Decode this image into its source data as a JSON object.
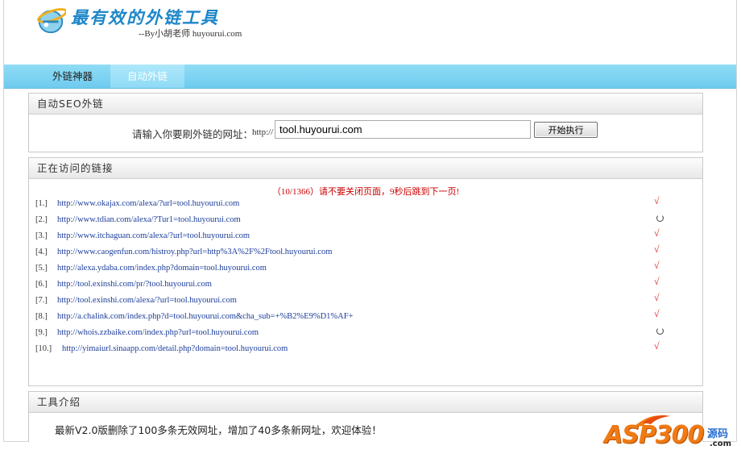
{
  "header": {
    "logo_icon": "ie-globe-icon",
    "title": "最有效的外链工具",
    "subtitle": "--By小胡老师 huyourui.com"
  },
  "nav": {
    "tabs": [
      {
        "label": "外链神器",
        "active": false
      },
      {
        "label": "自动外链",
        "active": true
      }
    ]
  },
  "seo_panel": {
    "title": "自动SEO外链",
    "prompt": "请输入你要刷外链的网址：",
    "prefix": "http://",
    "url_value": "tool.huyourui.com",
    "button_label": "开始执行"
  },
  "links_panel": {
    "title": "正在访问的链接",
    "notice": "（10/1366）请不要关闭页面，9秒后跳到下一页!",
    "links": [
      {
        "num": "[1.]",
        "url": "http://www.okajax.com/alexa/?url=tool.huyourui.com",
        "status": "done"
      },
      {
        "num": "[2.]",
        "url": "http://www.tdian.com/alexa/?Tur1=tool.huyourui.com",
        "status": "loading"
      },
      {
        "num": "[3.]",
        "url": "http://www.itchaguan.com/alexa/?url=tool.huyourui.com",
        "status": "done"
      },
      {
        "num": "[4.]",
        "url": "http://www.caogenfun.com/histroy.php?url=http%3A%2F%2Ftool.huyourui.com",
        "status": "done"
      },
      {
        "num": "[5.]",
        "url": "http://alexa.ydaba.com/index.php?domain=tool.huyourui.com",
        "status": "done"
      },
      {
        "num": "[6.]",
        "url": "http://tool.exinshi.com/pr/?tool.huyourui.com",
        "status": "done"
      },
      {
        "num": "[7.]",
        "url": "http://tool.exinshi.com/alexa/?url=tool.huyourui.com",
        "status": "done"
      },
      {
        "num": "[8.]",
        "url": "http://a.chalink.com/index.php?d=tool.huyourui.com&cha_sub=+%B2%E9%D1%AF+",
        "status": "done"
      },
      {
        "num": "[9.]",
        "url": "http://whois.zzbaike.com/index.php?url=tool.huyourui.com",
        "status": "loading"
      },
      {
        "num": "[10.]",
        "url": "http://yimaiurl.sinaapp.com/detail.php?domain=tool.huyourui.com",
        "status": "done"
      }
    ],
    "check_mark": "√",
    "colors": {
      "check": "#e02020",
      "link": "#1b3d9a",
      "notice": "#cc0000"
    }
  },
  "intro_panel": {
    "title": "工具介绍",
    "text": "最新V2.0版删除了100多条无效网址，增加了40多条新网址，欢迎体验！"
  },
  "watermark": {
    "brand": "ASP300",
    "cn": "源码",
    "domain": ".com"
  },
  "colors": {
    "nav": "#7fd3f2",
    "brand_blue": "#1c86c8",
    "watermark_orange": "#f07a14"
  }
}
